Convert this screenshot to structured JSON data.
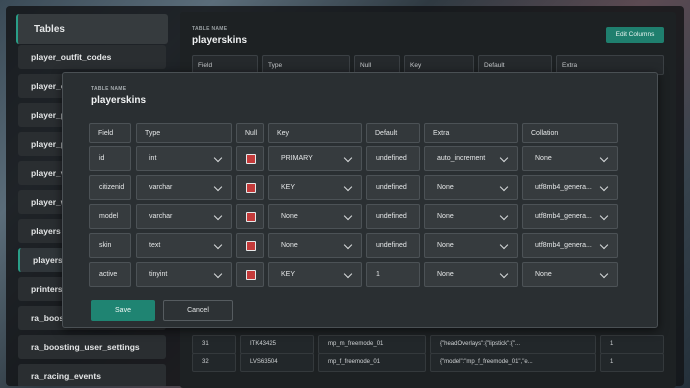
{
  "sidebar": {
    "header": "Tables",
    "items": [
      {
        "label": "player_outfit_codes"
      },
      {
        "label": "player_o"
      },
      {
        "label": "player_p"
      },
      {
        "label": "player_p"
      },
      {
        "label": "player_v"
      },
      {
        "label": "player_w"
      },
      {
        "label": "players"
      },
      {
        "label": "playersk"
      },
      {
        "label": "printers"
      },
      {
        "label": "ra_boosti"
      },
      {
        "label": "ra_boosting_user_settings"
      },
      {
        "label": "ra_racing_events"
      }
    ]
  },
  "background_table": {
    "label": "TABLE NAME",
    "name": "playerskins",
    "edit_button": "Edit Columns",
    "headers": [
      "Field",
      "Type",
      "Null",
      "Key",
      "Default",
      "Extra"
    ],
    "rows": [
      {
        "id": "31",
        "citizenid": "ITK43425",
        "model": "mp_m_freemode_01",
        "skin": "{\"headOverlays\":{\"lipstick\":{\"...",
        "active": "1"
      },
      {
        "id": "32",
        "citizenid": "LVS63504",
        "model": "mp_f_freemode_01",
        "skin": "{\"model\":\"mp_f_freemode_01\",\"e...",
        "active": "1"
      }
    ]
  },
  "modal": {
    "label": "TABLE NAME",
    "title": "playerskins",
    "headers": [
      "Field",
      "Type",
      "Null",
      "Key",
      "Default",
      "Extra",
      "Collation"
    ],
    "rows": [
      {
        "field": "id",
        "type": "int",
        "null": true,
        "key": "PRIMARY",
        "default": "undefined",
        "extra": "auto_increment",
        "collation": "None"
      },
      {
        "field": "citizenid",
        "type": "varchar",
        "null": true,
        "key": "KEY",
        "default": "undefined",
        "extra": "None",
        "collation": "utf8mb4_genera..."
      },
      {
        "field": "model",
        "type": "varchar",
        "null": true,
        "key": "None",
        "default": "undefined",
        "extra": "None",
        "collation": "utf8mb4_genera..."
      },
      {
        "field": "skin",
        "type": "text",
        "null": true,
        "key": "None",
        "default": "undefined",
        "extra": "None",
        "collation": "utf8mb4_genera..."
      },
      {
        "field": "active",
        "type": "tinyint",
        "null": true,
        "key": "KEY",
        "default": "1",
        "extra": "None",
        "collation": "None"
      }
    ],
    "save_label": "Save",
    "cancel_label": "Cancel"
  },
  "colors": {
    "accent": "#1f8472",
    "checkbox": "#c43a3a"
  }
}
